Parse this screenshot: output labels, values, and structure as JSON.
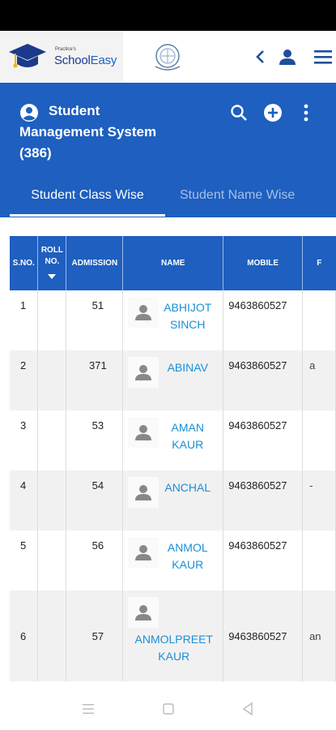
{
  "app": {
    "logo_small": "Practice's",
    "logo_school": "School",
    "logo_easy": "Easy"
  },
  "header": {
    "title": "Student Management System (386)"
  },
  "tabs": [
    {
      "label": "Student Class Wise"
    },
    {
      "label": "Student Name Wise"
    }
  ],
  "table": {
    "columns": {
      "sno": "S.NO.",
      "roll": "ROLL NO.",
      "admission": "ADMISSION",
      "name": "NAME",
      "mobile": "MOBILE",
      "extra": "F"
    },
    "rows": [
      {
        "sno": "1",
        "roll": "",
        "admission": "51",
        "name": "ABHIJOT SINCH",
        "mobile": "9463860527",
        "extra": ""
      },
      {
        "sno": "2",
        "roll": "",
        "admission": "371",
        "name": "ABINAV",
        "mobile": "9463860527",
        "extra": "a"
      },
      {
        "sno": "3",
        "roll": "",
        "admission": "53",
        "name": "AMAN KAUR",
        "mobile": "9463860527",
        "extra": ""
      },
      {
        "sno": "4",
        "roll": "",
        "admission": "54",
        "name": "ANCHAL",
        "mobile": "9463860527",
        "extra": "-"
      },
      {
        "sno": "5",
        "roll": "",
        "admission": "56",
        "name": "ANMOL KAUR",
        "mobile": "9463860527",
        "extra": ""
      },
      {
        "sno": "6",
        "roll": "",
        "admission": "57",
        "name": "ANMOLPREET KAUR",
        "mobile": "9463860527",
        "extra": "an"
      }
    ]
  },
  "colors": {
    "primary": "#1e5fbf",
    "link": "#1b8fd6",
    "row_alt": "#f1f1f1"
  },
  "icons": [
    "graduation-cap-icon",
    "emblem-icon",
    "back-chevron-icon",
    "user-icon",
    "menu-icon",
    "account-circle-icon",
    "search-icon",
    "add-circle-icon",
    "more-vert-icon",
    "avatar-icon",
    "sort-down-icon",
    "nav-menu-icon",
    "nav-home-icon",
    "nav-back-icon"
  ]
}
